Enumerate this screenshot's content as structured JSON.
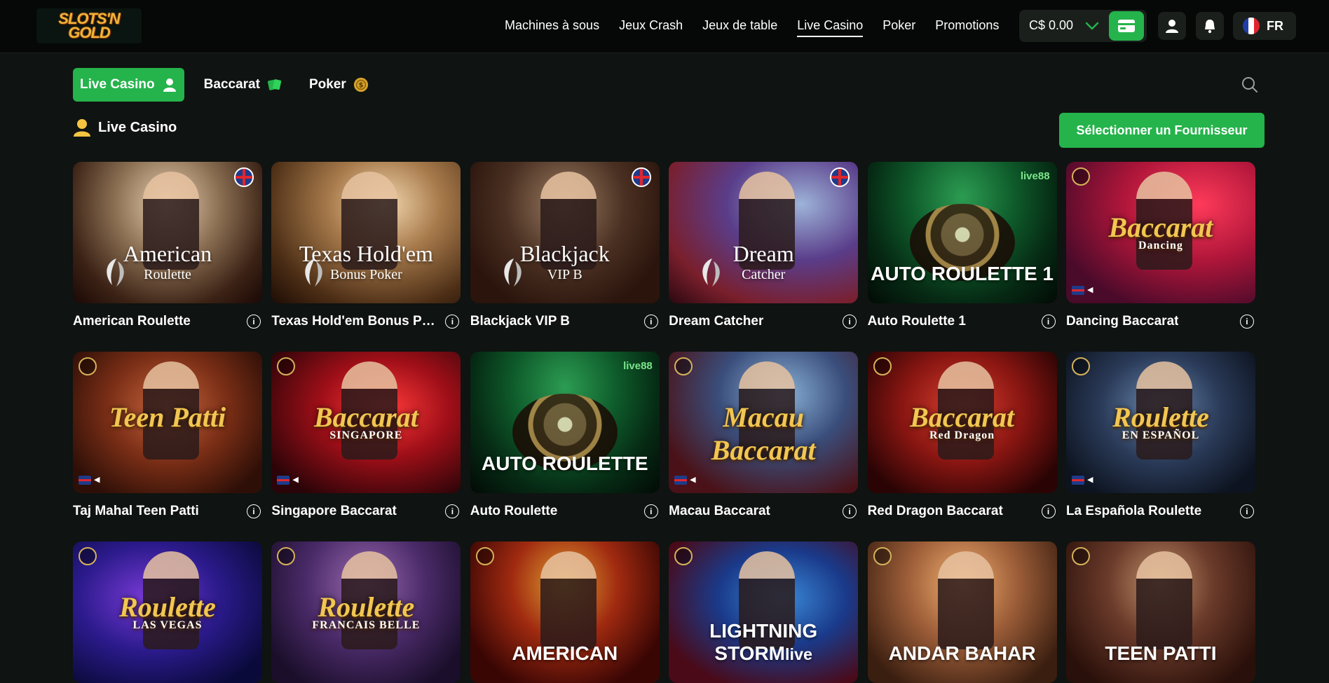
{
  "header": {
    "logo_text": "SLOTS'N GOLD",
    "nav": [
      {
        "label": "Machines à sous",
        "active": false
      },
      {
        "label": "Jeux Crash",
        "active": false
      },
      {
        "label": "Jeux de table",
        "active": false
      },
      {
        "label": "Live Casino",
        "active": true
      },
      {
        "label": "Poker",
        "active": false
      },
      {
        "label": "Promotions",
        "active": false
      }
    ],
    "balance": "C$ 0.00",
    "language": "FR"
  },
  "tabs": [
    {
      "label": "Live Casino",
      "active": true,
      "icon": "dealer-icon"
    },
    {
      "label": "Baccarat",
      "active": false,
      "icon": "cards-icon"
    },
    {
      "label": "Poker",
      "active": false,
      "icon": "chip-icon"
    }
  ],
  "section": {
    "title": "Live Casino",
    "provider_button": "Sélectionner un Fournisseur"
  },
  "games": [
    {
      "name": "American Roulette",
      "art_title": "American",
      "art_sub": "Roulette",
      "style": "serif",
      "bg": "bg-ar",
      "flag": true
    },
    {
      "name": "Texas Hold'em Bonus Po...",
      "art_title": "Texas Hold'em",
      "art_sub": "Bonus Poker",
      "style": "serif",
      "bg": "bg-th",
      "flag": false
    },
    {
      "name": "Blackjack VIP B",
      "art_title": "Blackjack",
      "art_sub": "VIP B",
      "style": "serif",
      "bg": "bg-bj",
      "flag": true
    },
    {
      "name": "Dream Catcher",
      "art_title": "Dream",
      "art_sub": "Catcher",
      "style": "serif",
      "bg": "bg-dc",
      "flag": true
    },
    {
      "name": "Auto Roulette 1",
      "art_title": "AUTO ROULETTE 1",
      "art_sub": "",
      "style": "bold",
      "bg": "bg-auto",
      "brand": "live88"
    },
    {
      "name": "Dancing Baccarat",
      "art_title": "Baccarat",
      "art_sub": "Dancing",
      "style": "script",
      "bg": "bg-db",
      "minis": true
    },
    {
      "name": "Taj Mahal Teen Patti",
      "art_title": "Teen Patti",
      "art_sub": "",
      "style": "script",
      "bg": "bg-tp",
      "minis": true
    },
    {
      "name": "Singapore Baccarat",
      "art_title": "Baccarat",
      "art_sub": "SINGAPORE",
      "style": "script",
      "bg": "bg-sg",
      "minis": true
    },
    {
      "name": "Auto Roulette",
      "art_title": "AUTO ROULETTE",
      "art_sub": "",
      "style": "bold",
      "bg": "bg-auto",
      "brand": "live88"
    },
    {
      "name": "Macau Baccarat",
      "art_title": "Macau Baccarat",
      "art_sub": "",
      "style": "script",
      "bg": "bg-mb",
      "minis": true
    },
    {
      "name": "Red Dragon Baccarat",
      "art_title": "Baccarat",
      "art_sub": "Red Dragon",
      "style": "script",
      "bg": "bg-rd",
      "minis": false
    },
    {
      "name": "La Española Roulette",
      "art_title": "Roulette",
      "art_sub": "EN ESPAÑOL",
      "style": "script",
      "bg": "bg-le",
      "minis": true
    },
    {
      "name": "",
      "art_title": "Roulette",
      "art_sub": "LAS VEGAS",
      "style": "script",
      "bg": "bg-lv"
    },
    {
      "name": "",
      "art_title": "Roulette",
      "art_sub": "FRANCAIS BELLE",
      "style": "script",
      "bg": "bg-fb"
    },
    {
      "name": "",
      "art_title": "AMERICAN",
      "art_sub": "",
      "style": "bold",
      "bg": "bg-am"
    },
    {
      "name": "",
      "art_title": "LIGHTNING STORM",
      "art_sub": "live",
      "style": "bold",
      "bg": "bg-ls"
    },
    {
      "name": "",
      "art_title": "ANDAR BAHAR",
      "art_sub": "",
      "style": "bold",
      "bg": "bg-ab"
    },
    {
      "name": "",
      "art_title": "TEEN PATTI",
      "art_sub": "",
      "style": "bold",
      "bg": "bg-tp2"
    }
  ],
  "colors": {
    "accent": "#25b34b",
    "background": "#0f1311",
    "header": "#050806"
  }
}
